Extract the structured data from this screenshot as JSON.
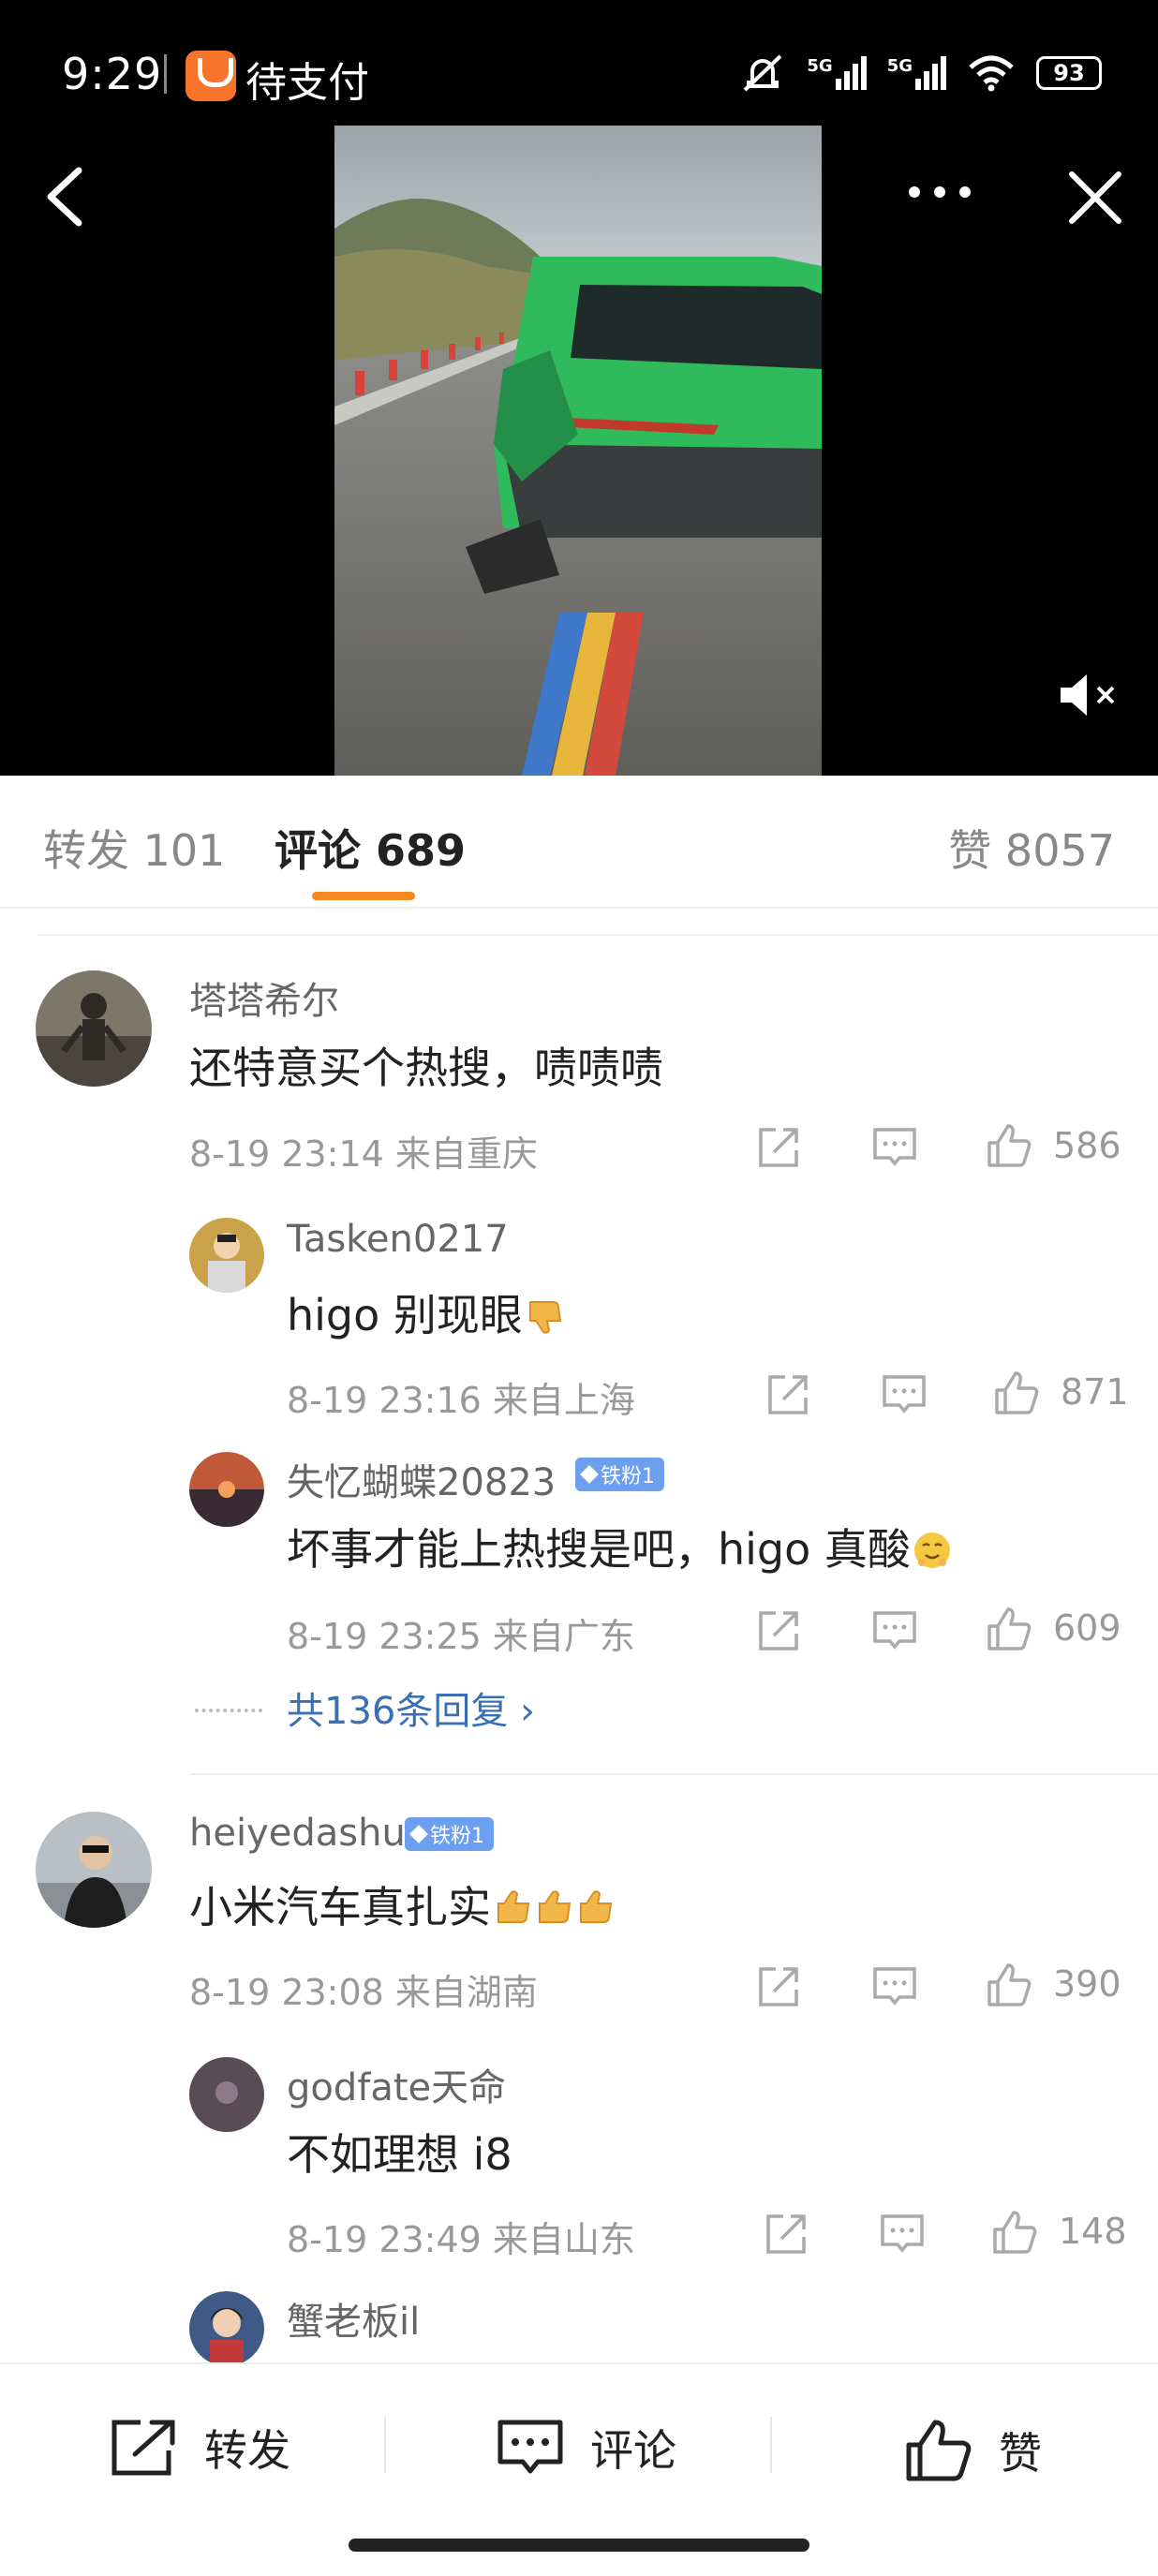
{
  "status_bar": {
    "time": "9:29",
    "app_name": "待支付",
    "network_1": "5G",
    "network_2": "5G",
    "battery": "93"
  },
  "tabs": {
    "repost_label": "转发",
    "repost_count": "101",
    "comment_label": "评论",
    "comment_count": "689",
    "like_label": "赞",
    "like_count": "8057"
  },
  "comments": [
    {
      "user": "塔塔希尔",
      "text": "还特意买个热搜，啧啧啧",
      "meta": "8-19 23:14  来自重庆",
      "likes": "586",
      "replies": [
        {
          "user": "Tasken0217",
          "text": "higo 别现眼",
          "emoji": "thumbs-down-emoji",
          "meta": "8-19 23:16  来自上海",
          "likes": "871"
        },
        {
          "user": "失忆蝴蝶20823",
          "badge": "铁粉1",
          "text": "坏事才能上热搜是吧，higo 真酸",
          "emoji": "smirk-emoji",
          "meta": "8-19 23:25  来自广东",
          "likes": "609"
        }
      ],
      "more_replies": "共136条回复 ›"
    },
    {
      "user": "heiyedashu",
      "badge": "铁粉1",
      "text": "小米汽车真扎实",
      "emoji": "thumbs-up-emoji",
      "meta": "8-19 23:08  来自湖南",
      "likes": "390",
      "replies": [
        {
          "user": "godfate天命",
          "text": "不如理想 i8",
          "meta": "8-19 23:49  来自山东",
          "likes": "148"
        },
        {
          "user": "蟹老板il"
        }
      ]
    }
  ],
  "bottom_bar": {
    "repost": "转发",
    "comment": "评论",
    "like": "赞"
  },
  "colors": {
    "accent": "#f5891f",
    "link": "#3b6fb4",
    "fan_badge": "#6c9ff0",
    "car": "#2fbb5c"
  }
}
